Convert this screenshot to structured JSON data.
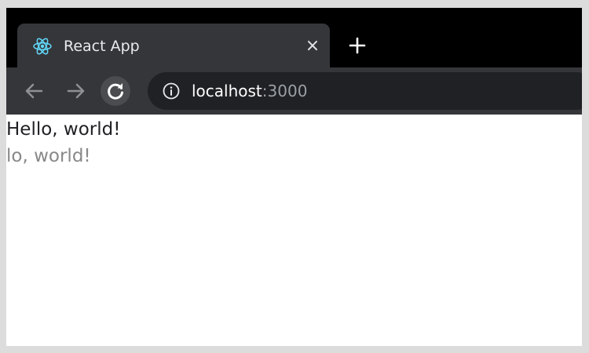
{
  "browser": {
    "tab": {
      "title": "React App",
      "favicon": "react-logo-icon",
      "close_icon": "close-icon",
      "close_label": "×"
    },
    "new_tab_icon": "plus-icon",
    "toolbar": {
      "back_icon": "arrow-left-icon",
      "forward_icon": "arrow-right-icon",
      "reload_icon": "reload-icon"
    },
    "address_bar": {
      "info_icon": "info-icon",
      "host": "localhost",
      "port": ":3000"
    }
  },
  "page": {
    "lines": [
      "Hello, world!",
      "lo, world!"
    ]
  },
  "colors": {
    "tabstrip_bg": "#000000",
    "tab_bg": "#35363a",
    "omnibox_bg": "#202124",
    "react_accent": "#61dafb",
    "primary_text": "#202124",
    "faded_text": "#888888"
  }
}
